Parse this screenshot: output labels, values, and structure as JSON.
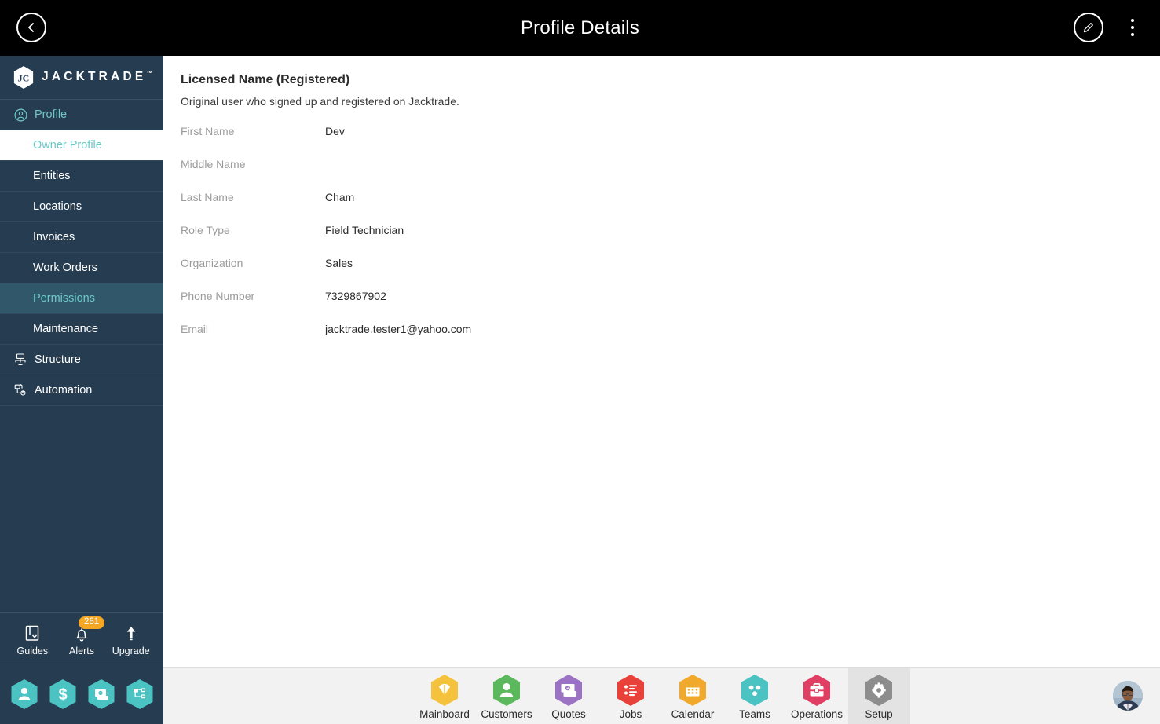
{
  "topbar": {
    "title": "Profile Details",
    "back_icon": "chevron-left-icon",
    "edit_icon": "pencil-icon",
    "menu_icon": "kebab-menu-icon"
  },
  "sidebar": {
    "brand": {
      "name": "JACKTRADE",
      "trademark": "™",
      "icon": "jacktrade-hex-logo"
    },
    "nav": [
      {
        "label": "Profile",
        "icon": "user-circle-icon",
        "type": "group",
        "state": "expanded"
      },
      {
        "label": "Owner Profile",
        "type": "sub",
        "state": "active-white"
      },
      {
        "label": "Entities",
        "type": "sub",
        "state": "normal"
      },
      {
        "label": "Locations",
        "type": "sub",
        "state": "normal"
      },
      {
        "label": "Invoices",
        "type": "sub",
        "state": "normal"
      },
      {
        "label": "Work Orders",
        "type": "sub",
        "state": "normal"
      },
      {
        "label": "Permissions",
        "type": "sub",
        "state": "active-teal"
      },
      {
        "label": "Maintenance",
        "type": "sub",
        "state": "normal"
      },
      {
        "label": "Structure",
        "icon": "structure-icon",
        "type": "group-plain",
        "state": "normal"
      },
      {
        "label": "Automation",
        "icon": "automation-icon",
        "type": "group-plain",
        "state": "normal"
      }
    ],
    "tools": [
      {
        "label": "Guides",
        "icon": "book-icon"
      },
      {
        "label": "Alerts",
        "icon": "bell-icon",
        "badge": "261"
      },
      {
        "label": "Upgrade",
        "icon": "up-arrow-icon"
      }
    ],
    "quick_hexes": [
      {
        "icon": "person-hex-icon"
      },
      {
        "icon": "dollar-hex-icon"
      },
      {
        "icon": "money-hex-icon"
      },
      {
        "icon": "workflow-hex-icon"
      }
    ]
  },
  "main": {
    "section_title": "Licensed Name (Registered)",
    "section_subtitle": "Original user who signed up and registered on Jacktrade.",
    "fields": [
      {
        "label": "First Name",
        "value": "Dev"
      },
      {
        "label": "Middle Name",
        "value": ""
      },
      {
        "label": "Last Name",
        "value": "Cham"
      },
      {
        "label": "Role Type",
        "value": "Field Technician"
      },
      {
        "label": "Organization",
        "value": "Sales"
      },
      {
        "label": "Phone Number",
        "value": "7329867902"
      },
      {
        "label": "Email",
        "value": "jacktrade.tester1@yahoo.com"
      }
    ]
  },
  "bottomnav": {
    "items": [
      {
        "label": "Mainboard",
        "icon": "mainboard-icon",
        "color": "#f5c23e",
        "active": false
      },
      {
        "label": "Customers",
        "icon": "customers-icon",
        "color": "#5cb85c",
        "active": false
      },
      {
        "label": "Quotes",
        "icon": "quotes-icon",
        "color": "#9b72c4",
        "active": false
      },
      {
        "label": "Jobs",
        "icon": "jobs-icon",
        "color": "#e8413a",
        "active": false
      },
      {
        "label": "Calendar",
        "icon": "calendar-icon",
        "color": "#f0a92a",
        "active": false
      },
      {
        "label": "Teams",
        "icon": "teams-icon",
        "color": "#4cc3c3",
        "active": false
      },
      {
        "label": "Operations",
        "icon": "operations-icon",
        "color": "#e03e62",
        "active": false
      },
      {
        "label": "Setup",
        "icon": "setup-gear-icon",
        "color": "#8d8d8d",
        "active": true
      }
    ],
    "avatar": "user-avatar"
  },
  "colors": {
    "topbar_bg": "#000000",
    "sidebar_bg": "#263c50",
    "sidebar_active_teal": "#31576a",
    "accent_teal": "#6fc8c8",
    "badge_orange": "#f5a623",
    "bottombar_bg": "#f2f2f2",
    "bottom_active_bg": "#e3e3e3",
    "hex_teal": "#4cc3c3"
  }
}
